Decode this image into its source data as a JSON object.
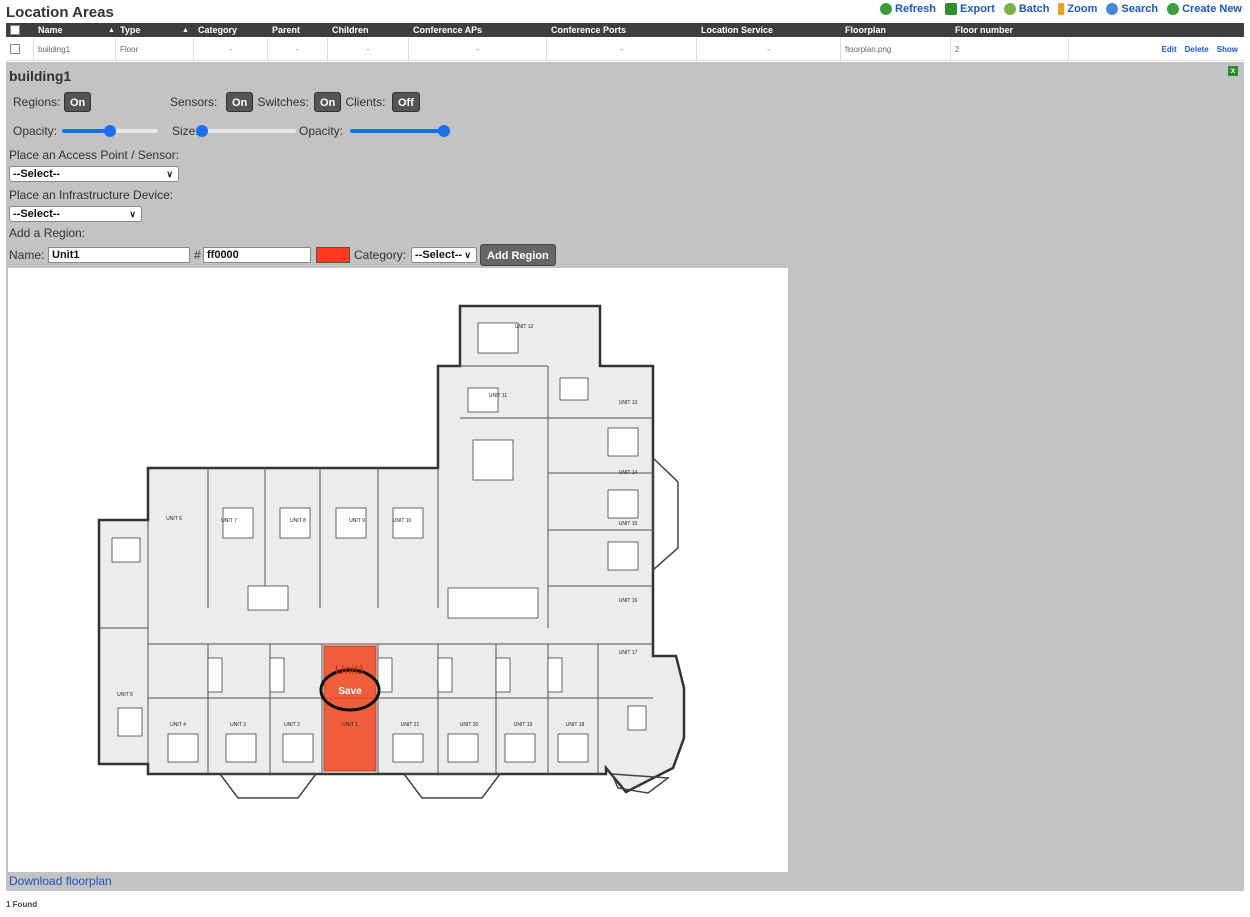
{
  "page": {
    "title": "Location Areas",
    "found_text": "1 Found"
  },
  "toolbar": {
    "refresh": "Refresh",
    "export": "Export",
    "batch": "Batch",
    "zoom": "Zoom",
    "search": "Search",
    "create_new": "Create New"
  },
  "table": {
    "columns": [
      "Name",
      "Type",
      "Category",
      "Parent",
      "Children",
      "Conference APs",
      "Conference Ports",
      "Location Service",
      "Floorplan",
      "Floor number"
    ],
    "row": {
      "name": "building1",
      "type": "Floor",
      "category": "-",
      "parent": "-",
      "children": "-",
      "conference_aps": "-",
      "conference_ports": "-",
      "location_service": "-",
      "floorplan": "floorplan.png",
      "floor_number": "2",
      "actions": [
        "Edit",
        "Delete",
        "Show"
      ]
    }
  },
  "detail": {
    "title": "building1",
    "regions_label": "Regions:",
    "regions_state": "On",
    "sensors_label": "Sensors:",
    "sensors_state": "On",
    "switches_label": "| Switches:",
    "switches_state": "On",
    "clients_label": "| Clients:",
    "clients_state": "Off",
    "opacity_label": "Opacity:",
    "size_label": "Size:",
    "opacity2_label": "Opacity:",
    "region_opacity_level": 0.5,
    "size_level": 0.0,
    "sensor_opacity_level": 1.0,
    "place_ap_label": "Place an Access Point / Sensor:",
    "place_ap_value": "--Select--",
    "place_infra_label": "Place an Infrastructure Device:",
    "place_infra_value": "--Select--",
    "add_region_label": "Add a Region:",
    "name_label": "Name:",
    "name_value": "Unit1",
    "hash": "#",
    "color_value": "ff0000",
    "color_swatch": "#ff3b1f",
    "category_label": "Category:",
    "category_value": "--Select--",
    "add_region_button": "Add Region",
    "download_link": "Download floorplan"
  },
  "floorplan": {
    "units": [
      "UNIT 12",
      "UNIT 11",
      "UNIT 13",
      "UNIT 14",
      "UNIT 15",
      "UNIT 16",
      "UNIT 17",
      "UNIT 6",
      "UNIT 7",
      "UNIT 8",
      "UNIT 9",
      "UNIT 10",
      "UNIT 5",
      "UNIT 4",
      "UNIT 3",
      "UNIT 2",
      "UNIT 1",
      "UNIT 21",
      "UNIT 20",
      "UNIT 19",
      "UNIT 18"
    ],
    "region_label": "Unit1",
    "save_label": "Save",
    "region_color": "#f0522c"
  }
}
